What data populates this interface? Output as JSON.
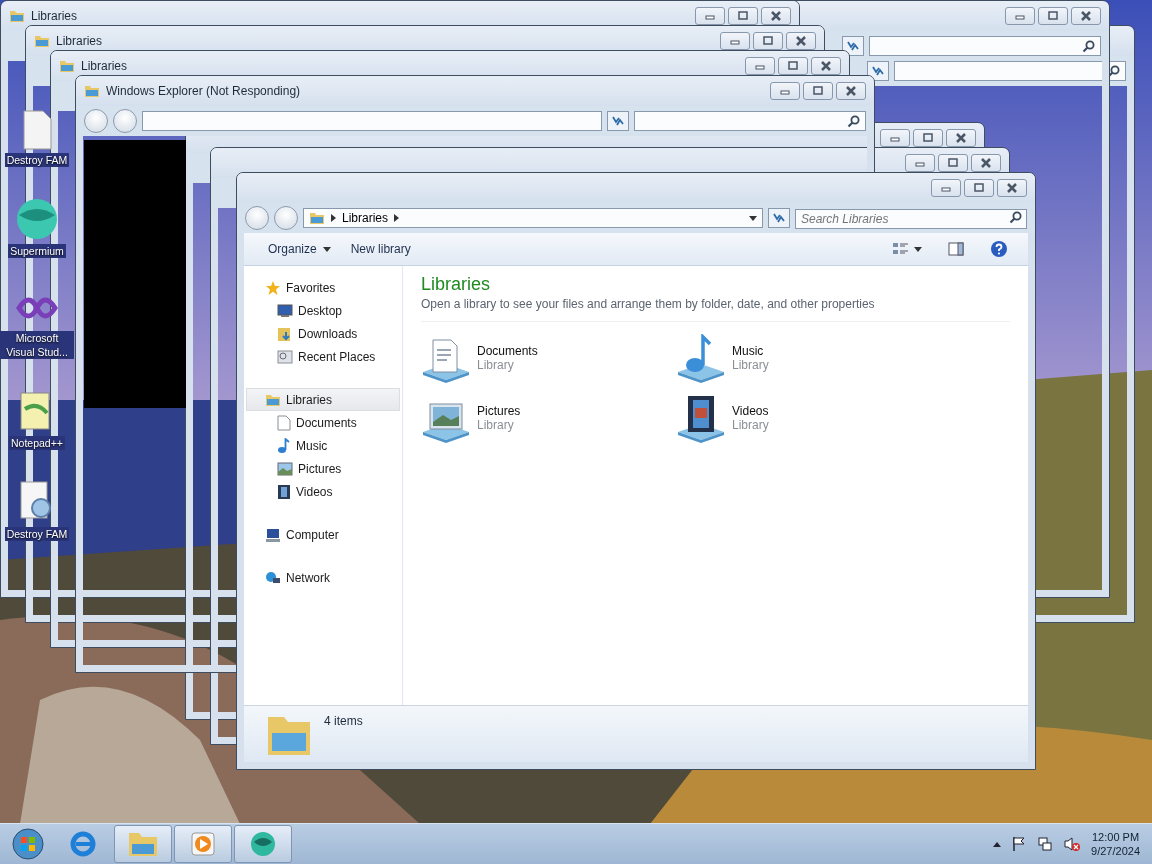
{
  "desktop_icons": [
    {
      "label": "Destroy FAM"
    },
    {
      "label": "Supermium"
    },
    {
      "label": "Microsoft Visual Stud..."
    },
    {
      "label": "Notepad++"
    },
    {
      "label": "Destroy FAM"
    }
  ],
  "ghost_windows": [
    {
      "title": "Libraries"
    },
    {
      "title": "Libraries"
    },
    {
      "title": "Libraries"
    },
    {
      "title": "Windows Explorer (Not Responding)"
    }
  ],
  "explorer": {
    "breadcrumb": "Libraries",
    "search": {
      "placeholder": "Search Libraries"
    },
    "toolbar": [
      "Organize",
      "New library"
    ],
    "sidebar": [
      {
        "label": "Favorites",
        "selected": false,
        "children": [
          {
            "label": "Desktop",
            "selected": false
          },
          {
            "label": "Downloads",
            "selected": false
          },
          {
            "label": "Recent Places",
            "selected": false
          }
        ]
      },
      {
        "label": "Libraries",
        "selected": true,
        "children": [
          {
            "label": "Documents",
            "selected": false
          },
          {
            "label": "Music",
            "selected": false
          },
          {
            "label": "Pictures",
            "selected": false
          },
          {
            "label": "Videos",
            "selected": false
          }
        ]
      },
      {
        "label": "Computer",
        "selected": false
      },
      {
        "label": "Network",
        "selected": false
      }
    ],
    "heading": "Libraries",
    "description": "Open a library to see your files and arrange them by folder, date, and other properties",
    "libraries": [
      {
        "name": "Documents",
        "type": "Library"
      },
      {
        "name": "Music",
        "type": "Library"
      },
      {
        "name": "Pictures",
        "type": "Library"
      },
      {
        "name": "Videos",
        "type": "Library"
      }
    ],
    "status": "4 items"
  },
  "clock": {
    "time": "12:00 PM",
    "date": "9/27/2024"
  }
}
